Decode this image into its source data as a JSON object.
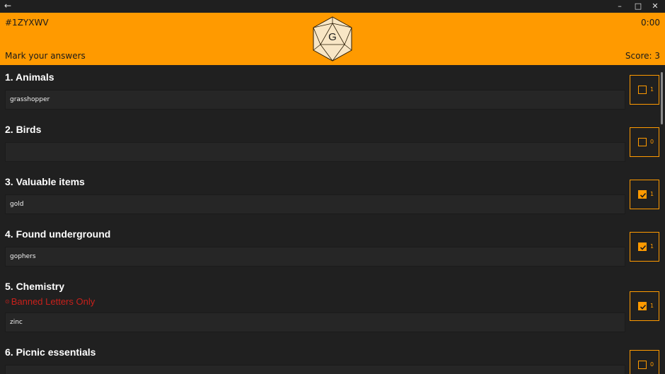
{
  "titlebar": {
    "back_icon": "back-arrow-icon",
    "minimize_icon": "minimize-icon",
    "maximize_icon": "maximize-icon",
    "close_icon": "close-icon"
  },
  "header": {
    "game_code": "#1ZYXWV",
    "timer": "0:00",
    "instruction": "Mark your answers",
    "score": "Score: 3",
    "logo_letter": "G",
    "color": "#ff9a00"
  },
  "categories": [
    {
      "title": "1. Animals",
      "answer": "grasshopper",
      "checked": false,
      "points": "1"
    },
    {
      "title": "2. Birds",
      "answer": "",
      "checked": false,
      "points": "0"
    },
    {
      "title": "3. Valuable items",
      "answer": "gold",
      "checked": true,
      "points": "1"
    },
    {
      "title": "4. Found underground",
      "answer": "gophers",
      "checked": true,
      "points": "1"
    },
    {
      "title": "5. Chemistry",
      "warning": "Banned Letters Only",
      "answer": "zinc",
      "checked": true,
      "points": "1"
    },
    {
      "title": "6. Picnic essentials",
      "answer": "",
      "checked": false,
      "points": "0"
    }
  ]
}
